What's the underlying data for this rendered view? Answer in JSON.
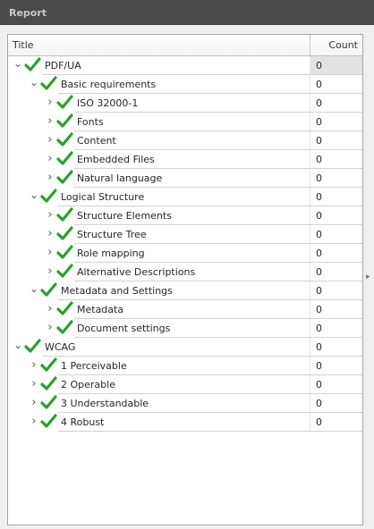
{
  "window": {
    "title": "Report"
  },
  "table": {
    "col_title": "Title",
    "col_count": "Count"
  },
  "colors": {
    "check": "#2aa12a",
    "selected_count_bg": "#e2e2e2"
  },
  "rows": [
    {
      "label": "PDF/UA",
      "count": "0",
      "level": 0,
      "expanded": true,
      "icon": "green-check-icon"
    },
    {
      "label": "Basic requirements",
      "count": "0",
      "level": 1,
      "expanded": true,
      "icon": "green-check-icon"
    },
    {
      "label": "ISO 32000-1",
      "count": "0",
      "level": 2,
      "expanded": false,
      "icon": "green-check-icon"
    },
    {
      "label": "Fonts",
      "count": "0",
      "level": 2,
      "expanded": false,
      "icon": "green-check-icon"
    },
    {
      "label": "Content",
      "count": "0",
      "level": 2,
      "expanded": false,
      "icon": "green-check-icon"
    },
    {
      "label": "Embedded Files",
      "count": "0",
      "level": 2,
      "expanded": false,
      "icon": "green-check-icon"
    },
    {
      "label": "Natural language",
      "count": "0",
      "level": 2,
      "expanded": false,
      "icon": "green-check-icon"
    },
    {
      "label": "Logical Structure",
      "count": "0",
      "level": 1,
      "expanded": true,
      "icon": "green-check-icon"
    },
    {
      "label": "Structure Elements",
      "count": "0",
      "level": 2,
      "expanded": false,
      "icon": "green-check-icon"
    },
    {
      "label": "Structure Tree",
      "count": "0",
      "level": 2,
      "expanded": false,
      "icon": "green-check-icon"
    },
    {
      "label": "Role mapping",
      "count": "0",
      "level": 2,
      "expanded": false,
      "icon": "green-check-icon"
    },
    {
      "label": "Alternative Descriptions",
      "count": "0",
      "level": 2,
      "expanded": false,
      "icon": "green-check-icon"
    },
    {
      "label": "Metadata and Settings",
      "count": "0",
      "level": 1,
      "expanded": true,
      "icon": "green-check-icon"
    },
    {
      "label": "Metadata",
      "count": "0",
      "level": 2,
      "expanded": false,
      "icon": "green-check-icon"
    },
    {
      "label": "Document settings",
      "count": "0",
      "level": 2,
      "expanded": false,
      "icon": "green-check-icon"
    },
    {
      "label": "WCAG",
      "count": "0",
      "level": 0,
      "expanded": true,
      "icon": "green-check-icon"
    },
    {
      "label": "1 Perceivable",
      "count": "0",
      "level": 1,
      "expanded": false,
      "icon": "green-check-icon"
    },
    {
      "label": "2 Operable",
      "count": "0",
      "level": 1,
      "expanded": false,
      "icon": "green-check-icon"
    },
    {
      "label": "3 Understandable",
      "count": "0",
      "level": 1,
      "expanded": false,
      "icon": "green-check-icon"
    },
    {
      "label": "4 Robust",
      "count": "0",
      "level": 1,
      "expanded": false,
      "icon": "green-check-icon"
    }
  ]
}
